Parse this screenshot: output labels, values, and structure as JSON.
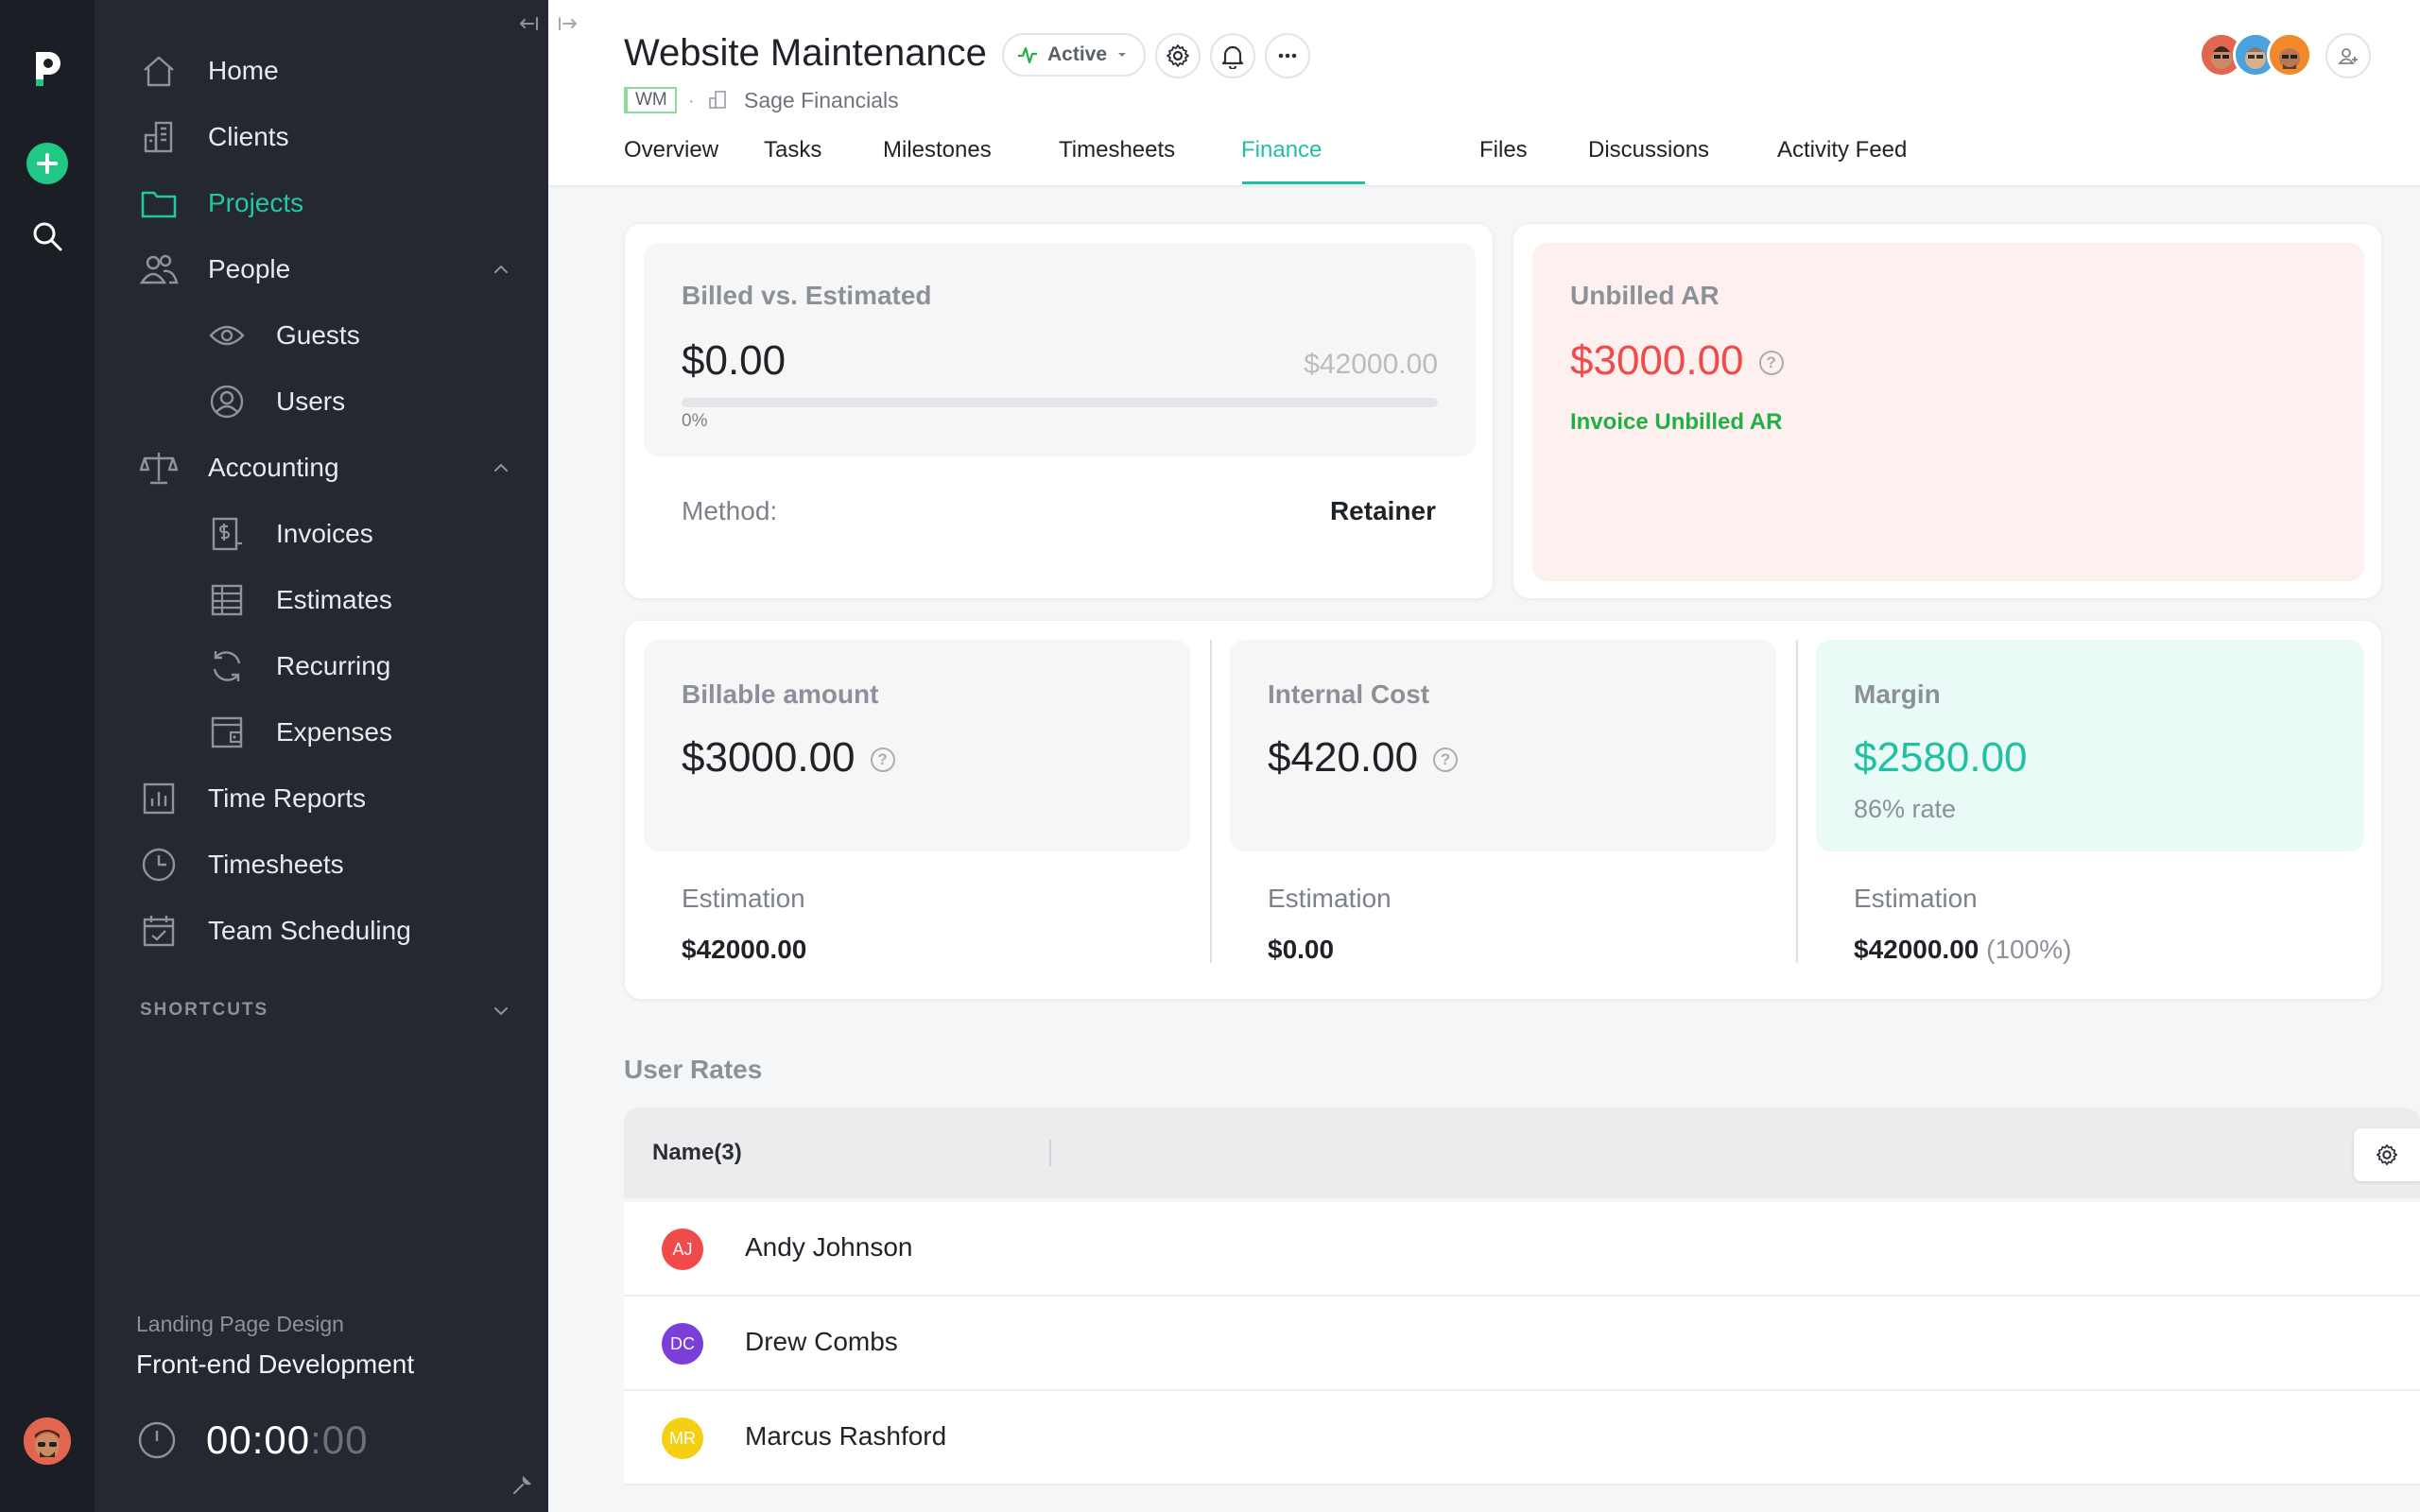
{
  "sidebar": {
    "items": [
      {
        "key": "home",
        "label": "Home"
      },
      {
        "key": "clients",
        "label": "Clients"
      },
      {
        "key": "projects",
        "label": "Projects"
      },
      {
        "key": "people",
        "label": "People"
      },
      {
        "key": "guests",
        "label": "Guests"
      },
      {
        "key": "users",
        "label": "Users"
      },
      {
        "key": "accounting",
        "label": "Accounting"
      },
      {
        "key": "invoices",
        "label": "Invoices"
      },
      {
        "key": "estimates",
        "label": "Estimates"
      },
      {
        "key": "recurring",
        "label": "Recurring"
      },
      {
        "key": "expenses",
        "label": "Expenses"
      },
      {
        "key": "time-reports",
        "label": "Time Reports"
      },
      {
        "key": "timesheets",
        "label": "Timesheets"
      },
      {
        "key": "team-scheduling",
        "label": "Team Scheduling"
      }
    ],
    "shortcuts_label": "SHORTCUTS",
    "timer": {
      "project": "Landing Page Design",
      "task": "Front-end Development",
      "time_main": "00:00",
      "time_seconds": ":00"
    }
  },
  "header": {
    "title": "Website Maintenance",
    "status": "Active",
    "code": "WM",
    "client": "Sage Financials",
    "tabs": [
      "Overview",
      "Tasks",
      "Milestones",
      "Timesheets",
      "Finance",
      "Files",
      "Discussions",
      "Activity Feed"
    ],
    "active_tab": "Finance"
  },
  "finance": {
    "billed": {
      "label": "Billed vs. Estimated",
      "value": "$0.00",
      "estimated": "$42000.00",
      "percent_label": "0%",
      "progress": 0,
      "method_label": "Method:",
      "method_value": "Retainer"
    },
    "unbilled": {
      "label": "Unbilled AR",
      "value": "$3000.00",
      "action": "Invoice Unbilled AR"
    },
    "billable": {
      "label": "Billable amount",
      "value": "$3000.00",
      "est_label": "Estimation",
      "est_value": "$42000.00"
    },
    "internal": {
      "label": "Internal Cost",
      "value": "$420.00",
      "est_label": "Estimation",
      "est_value": "$0.00"
    },
    "margin": {
      "label": "Margin",
      "value": "$2580.00",
      "rate": "86% rate",
      "est_label": "Estimation",
      "est_value": "$42000.00",
      "est_pct": "(100%)"
    },
    "help_glyph": "?"
  },
  "user_rates": {
    "title": "User Rates",
    "column_name": "Name(3)",
    "users": [
      {
        "initials": "AJ",
        "name": "Andy Johnson",
        "color": "#f04a4a"
      },
      {
        "initials": "DC",
        "name": "Drew Combs",
        "color": "#7a3fd8"
      },
      {
        "initials": "MR",
        "name": "Marcus Rashford",
        "color": "#f5cf14"
      }
    ]
  },
  "colors": {
    "accent": "#22c0a3",
    "brand_green": "#20c883",
    "danger": "#f04a4a",
    "link_green": "#22b045",
    "sidebar_bg": "#242830",
    "rail_bg": "#1b1e25"
  },
  "icons": {
    "home": "home-icon",
    "clients": "building-icon",
    "projects": "folder-icon",
    "people": "people-icon",
    "guests": "eye-icon",
    "users": "user-circle-icon",
    "accounting": "scale-icon",
    "invoices": "invoice-icon",
    "estimates": "table-icon",
    "recurring": "refresh-icon",
    "expenses": "wallet-icon",
    "time_reports": "chart-icon",
    "timesheets": "clock-icon",
    "team_scheduling": "calendar-icon"
  }
}
